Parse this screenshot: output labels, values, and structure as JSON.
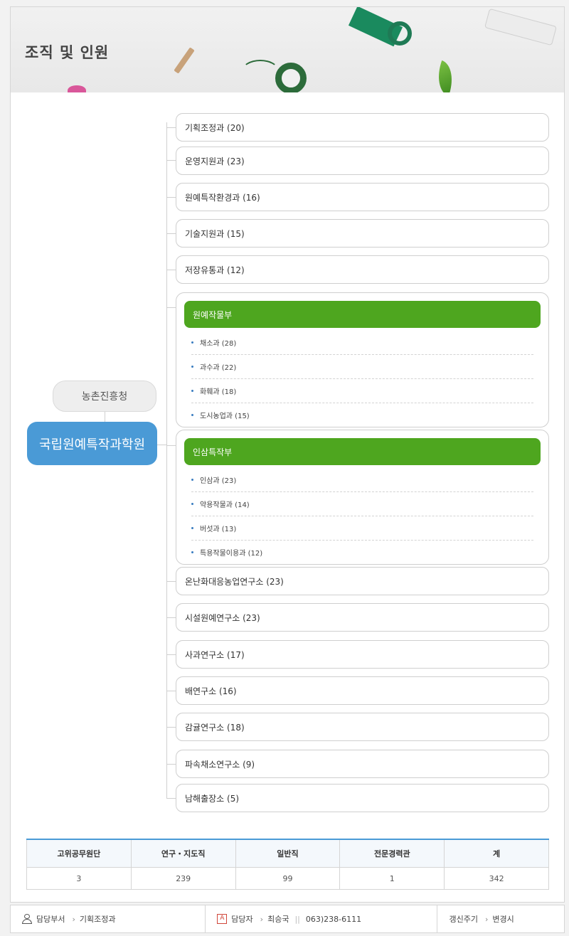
{
  "page_title": "조직 및 인원",
  "org": {
    "parent": "농촌진흥청",
    "root": "국립원예특작과학원",
    "units_top": [
      "기획조정과 (20)",
      "운영지원과 (23)",
      "원예특작환경과 (16)",
      "기술지원과 (15)",
      "저장유통과 (12)"
    ],
    "groups": [
      {
        "name": "원예작물부",
        "subunits": [
          "채소과 (28)",
          "과수과 (22)",
          "화훼과 (18)",
          "도시농업과 (15)"
        ]
      },
      {
        "name": "인삼특작부",
        "subunits": [
          "인삼과 (23)",
          "약용작물과 (14)",
          "버섯과 (13)",
          "특용작물이용과 (12)"
        ]
      }
    ],
    "units_bottom": [
      "온난화대응농업연구소 (23)",
      "시설원예연구소 (23)",
      "사과연구소 (17)",
      "배연구소 (16)",
      "감귤연구소 (18)",
      "파속채소연구소 (9)",
      "남해출장소 (5)"
    ]
  },
  "staff_table": {
    "headers": [
      "고위공무원단",
      "연구・지도직",
      "일반직",
      "전문경력관",
      "계"
    ],
    "values": [
      "3",
      "239",
      "99",
      "1",
      "342"
    ]
  },
  "footer": {
    "dept_label": "담당부서",
    "dept_value": "기획조정과",
    "person_label": "담당자",
    "person_value": "최승국",
    "phone": "063)238-6111",
    "cycle_label": "갱신주기",
    "cycle_value": "변경시",
    "badge_char": "A"
  },
  "colors": {
    "root_blue": "#4a9ad6",
    "group_green": "#4ea61f",
    "table_accent": "#4a9ad6"
  }
}
